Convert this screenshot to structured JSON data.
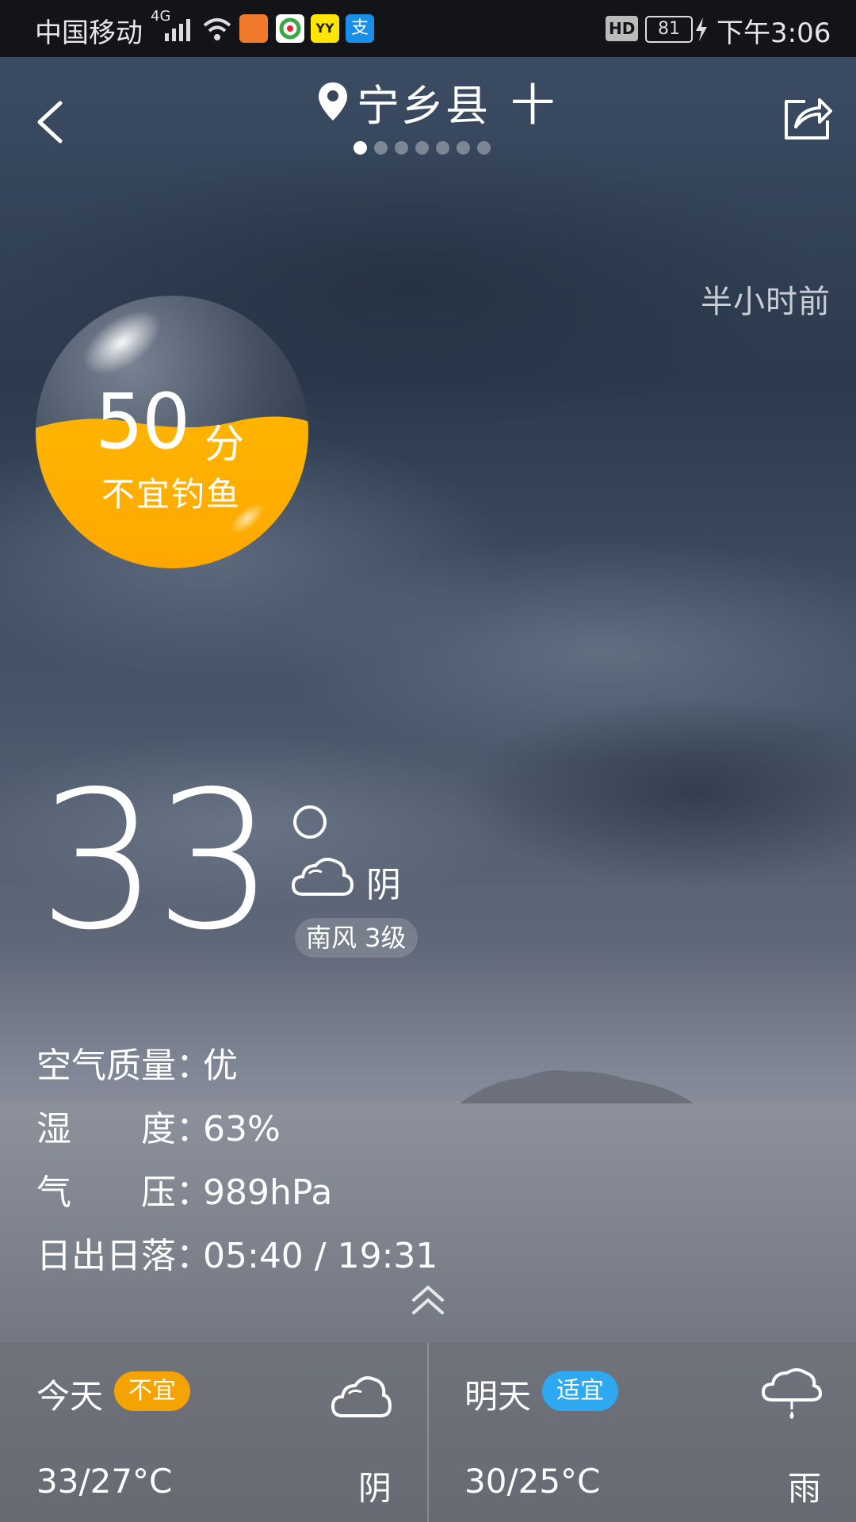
{
  "status_bar": {
    "carrier": "中国移动",
    "network": "4G",
    "battery": "81",
    "time": "下午3:06",
    "hd": "HD",
    "app_icons": [
      "uc-browser-icon",
      "photo-app-icon",
      "yy-icon",
      "alipay-icon"
    ]
  },
  "header": {
    "city": "宁乡县",
    "add_symbol": "十",
    "page_count": 7,
    "active_page": 0
  },
  "updated": "半小时前",
  "score": {
    "value": "50",
    "unit": "分",
    "desc": "不宜钓鱼",
    "level": 0.5,
    "color": "#FFAA00"
  },
  "current": {
    "temp": "33",
    "condition": "阴",
    "wind": "南风 3级"
  },
  "details": [
    {
      "label": "空气质量：",
      "value": "优"
    },
    {
      "label": "湿　　度：",
      "value": "63%"
    },
    {
      "label": "气　　压：",
      "value": "989hPa"
    },
    {
      "label": "日出日落：",
      "value": "05:40 / 19:31"
    }
  ],
  "forecast": [
    {
      "day": "今天",
      "badge": "不宜",
      "badge_color": "#F5A300",
      "temp": "33/27°C",
      "condition": "阴",
      "icon": "cloudy-icon"
    },
    {
      "day": "明天",
      "badge": "适宜",
      "badge_color": "#2EA8F0",
      "temp": "30/25°C",
      "condition": "雨",
      "icon": "rain-icon"
    }
  ]
}
